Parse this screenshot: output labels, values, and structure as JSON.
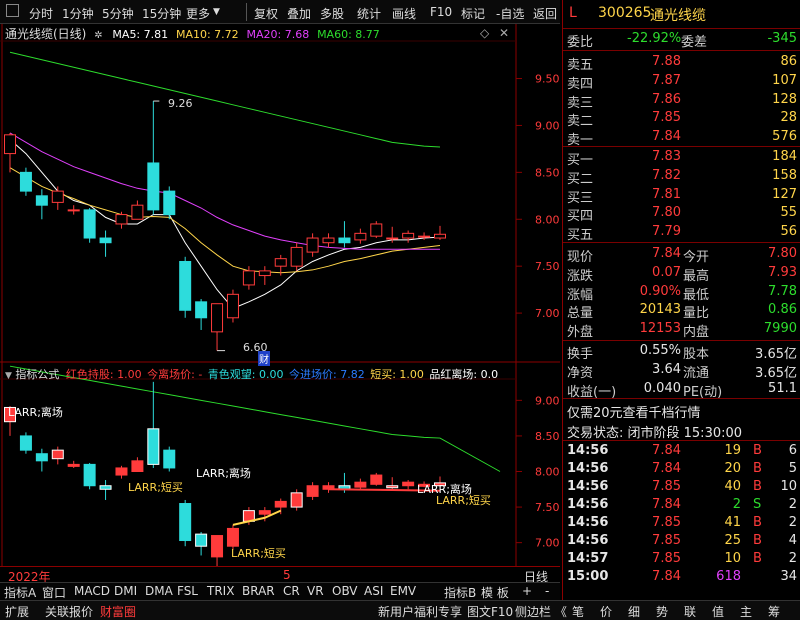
{
  "toolbar": {
    "checkbox_icon": "checkbox-icon",
    "items": [
      "分时",
      "1分钟",
      "5分钟",
      "15分钟",
      "更多",
      "复权",
      "叠加",
      "多股",
      "统计",
      "画线",
      "F10",
      "标记",
      "-自选",
      "返回"
    ]
  },
  "main_chart": {
    "title": "通光线缆(日线)",
    "ma": [
      {
        "label": "MA5: 7.81",
        "color": "#ffffff"
      },
      {
        "label": "MA10: 7.72",
        "color": "#ffd54a"
      },
      {
        "label": "MA20: 7.68",
        "color": "#e040fb"
      },
      {
        "label": "MA60: 8.77",
        "color": "#2ddc2d"
      }
    ],
    "high_marker": "9.26",
    "low_marker": "6.60",
    "badge": "财"
  },
  "indicator": {
    "name": "指标公式",
    "params": [
      {
        "label": "红色持股: 1.00",
        "color": "#ff3b3b"
      },
      {
        "label": "今离场价: -",
        "color": "#ff3b3b"
      },
      {
        "label": "青色观望: 0.00",
        "color": "#2ddcdc"
      },
      {
        "label": "今进场价: 7.82",
        "color": "#2a7bff"
      },
      {
        "label": "短买: 1.00",
        "color": "#ffd54a"
      },
      {
        "label": "品红离场: 0.0",
        "color": "#ffffff"
      }
    ],
    "annotations": [
      "LARR;离场",
      "LARR;短买",
      "LARR;离场",
      "LARR;短买",
      "LARR;离场",
      "LARR;短买"
    ]
  },
  "time_axis": {
    "year": "2022年",
    "month": "5",
    "period": "日线"
  },
  "bottom_tabs": [
    "指标A",
    "窗口",
    "MACD",
    "DMI",
    "DMA",
    "FSL",
    "TRIX",
    "BRAR",
    "CR",
    "VR",
    "OBV",
    "ASI",
    "EMV",
    "指标B",
    "模 板",
    "+",
    "-"
  ],
  "status_bar": {
    "left": [
      "扩展",
      "关联报价",
      "财富圈"
    ],
    "mid": [
      "新用户福利专享",
      "图文F10",
      "侧边栏 《"
    ],
    "right": [
      "笔",
      "价",
      "细",
      "势",
      "联",
      "值",
      "主",
      "筹"
    ]
  },
  "quote": {
    "prefix": "L",
    "code": "300265",
    "name": "通光线缆",
    "weibi_label": "委比",
    "weibi": "-22.92%",
    "weicha_label": "委差",
    "weicha": "-345",
    "asks": [
      {
        "label": "卖五",
        "price": "7.88",
        "vol": "86"
      },
      {
        "label": "卖四",
        "price": "7.87",
        "vol": "107"
      },
      {
        "label": "卖三",
        "price": "7.86",
        "vol": "128"
      },
      {
        "label": "卖二",
        "price": "7.85",
        "vol": "28"
      },
      {
        "label": "卖一",
        "price": "7.84",
        "vol": "576"
      }
    ],
    "bids": [
      {
        "label": "买一",
        "price": "7.83",
        "vol": "184"
      },
      {
        "label": "买二",
        "price": "7.82",
        "vol": "158"
      },
      {
        "label": "买三",
        "price": "7.81",
        "vol": "127"
      },
      {
        "label": "买四",
        "price": "7.80",
        "vol": "55"
      },
      {
        "label": "买五",
        "price": "7.79",
        "vol": "56"
      }
    ],
    "stats": [
      [
        "现价",
        "7.84",
        "今开",
        "7.80"
      ],
      [
        "涨跌",
        "0.07",
        "最高",
        "7.93"
      ],
      [
        "涨幅",
        "0.90%",
        "最低",
        "7.78"
      ],
      [
        "总量",
        "20143",
        "量比",
        "0.86"
      ],
      [
        "外盘",
        "12153",
        "内盘",
        "7990"
      ]
    ],
    "stats2": [
      [
        "换手",
        "0.55%",
        "股本",
        "3.65亿"
      ],
      [
        "净资",
        "3.64",
        "流通",
        "3.65亿"
      ],
      [
        "收益(一)",
        "0.040",
        "PE(动)",
        "51.1"
      ]
    ],
    "promo": "仅需20元查看千档行情",
    "trade_status": "交易状态: 闭市阶段 15:30:00",
    "ticks": [
      [
        "14:56",
        "7.84",
        "19",
        "B",
        "6"
      ],
      [
        "14:56",
        "7.84",
        "20",
        "B",
        "5"
      ],
      [
        "14:56",
        "7.85",
        "40",
        "B",
        "10"
      ],
      [
        "14:56",
        "7.84",
        "2",
        "S",
        "2"
      ],
      [
        "14:56",
        "7.85",
        "41",
        "B",
        "2"
      ],
      [
        "14:56",
        "7.85",
        "25",
        "B",
        "4"
      ],
      [
        "14:57",
        "7.85",
        "10",
        "B",
        "2"
      ],
      [
        "15:00",
        "7.84",
        "618",
        "",
        "34"
      ]
    ]
  },
  "axes": {
    "main_ticks": [
      "9.50",
      "9.00",
      "8.50",
      "8.00",
      "7.50",
      "7.00"
    ],
    "ind_ticks": [
      "9.00",
      "8.50",
      "8.00",
      "7.50",
      "7.00"
    ]
  },
  "chart_data": {
    "type": "candlestick",
    "candles": [
      [
        8.7,
        8.9,
        8.5,
        8.92
      ],
      [
        8.5,
        8.3,
        8.25,
        8.55
      ],
      [
        8.25,
        8.15,
        8.0,
        8.32
      ],
      [
        8.18,
        8.3,
        8.1,
        8.35
      ],
      [
        8.1,
        8.1,
        8.05,
        8.15
      ],
      [
        8.1,
        7.8,
        7.75,
        8.12
      ],
      [
        7.8,
        7.75,
        7.6,
        7.88
      ],
      [
        7.95,
        8.05,
        7.9,
        8.08
      ],
      [
        8.0,
        8.15,
        8.0,
        8.2
      ],
      [
        8.6,
        8.1,
        8.05,
        9.26
      ],
      [
        8.3,
        8.05,
        8.0,
        8.35
      ],
      [
        7.55,
        7.03,
        6.95,
        7.6
      ],
      [
        7.12,
        6.95,
        6.82,
        7.15
      ],
      [
        6.8,
        7.1,
        6.6,
        7.1
      ],
      [
        6.95,
        7.2,
        6.9,
        7.25
      ],
      [
        7.3,
        7.45,
        7.25,
        7.5
      ],
      [
        7.4,
        7.45,
        7.3,
        7.5
      ],
      [
        7.5,
        7.58,
        7.4,
        7.62
      ],
      [
        7.5,
        7.7,
        7.45,
        7.75
      ],
      [
        7.65,
        7.8,
        7.6,
        7.85
      ],
      [
        7.75,
        7.8,
        7.7,
        7.85
      ],
      [
        7.8,
        7.75,
        7.7,
        7.98
      ],
      [
        7.78,
        7.85,
        7.74,
        7.9
      ],
      [
        7.82,
        7.95,
        7.8,
        7.98
      ],
      [
        7.8,
        7.8,
        7.75,
        7.92
      ],
      [
        7.8,
        7.85,
        7.75,
        7.88
      ],
      [
        7.82,
        7.82,
        7.78,
        7.86
      ],
      [
        7.8,
        7.84,
        7.78,
        7.93
      ]
    ],
    "ma_series": {
      "MA5": [
        8.85,
        8.7,
        8.5,
        8.3,
        8.2,
        8.15,
        8.02,
        7.95,
        7.95,
        8.05,
        8.05,
        7.75,
        7.5,
        7.25,
        7.05,
        7.12,
        7.2,
        7.3,
        7.45,
        7.55,
        7.62,
        7.68,
        7.7,
        7.75,
        7.78,
        7.78,
        7.8,
        7.81
      ],
      "MA10": [
        8.55,
        8.45,
        8.35,
        8.28,
        8.22,
        8.15,
        8.1,
        8.05,
        8.02,
        8.03,
        8.02,
        7.9,
        7.75,
        7.62,
        7.5,
        7.45,
        7.44,
        7.43,
        7.44,
        7.46,
        7.5,
        7.55,
        7.58,
        7.62,
        7.66,
        7.68,
        7.7,
        7.72
      ],
      "MA20": [
        8.92,
        8.82,
        8.72,
        8.64,
        8.56,
        8.5,
        8.44,
        8.38,
        8.33,
        8.3,
        8.28,
        8.2,
        8.12,
        8.02,
        7.94,
        7.88,
        7.82,
        7.78,
        7.75,
        7.72,
        7.7,
        7.69,
        7.68,
        7.68,
        7.68,
        7.68,
        7.68,
        7.68
      ],
      "MA60": [
        9.78,
        9.74,
        9.7,
        9.66,
        9.62,
        9.58,
        9.54,
        9.5,
        9.46,
        9.42,
        9.38,
        9.34,
        9.3,
        9.26,
        9.22,
        9.18,
        9.14,
        9.1,
        9.06,
        9.02,
        8.98,
        8.94,
        8.9,
        8.86,
        8.82,
        8.8,
        8.78,
        8.77
      ]
    },
    "ylim": [
      6.5,
      9.9
    ]
  },
  "colors": {
    "up": "#ff3b3b",
    "down": "#2ddcdc",
    "axis": "#8b0000"
  }
}
